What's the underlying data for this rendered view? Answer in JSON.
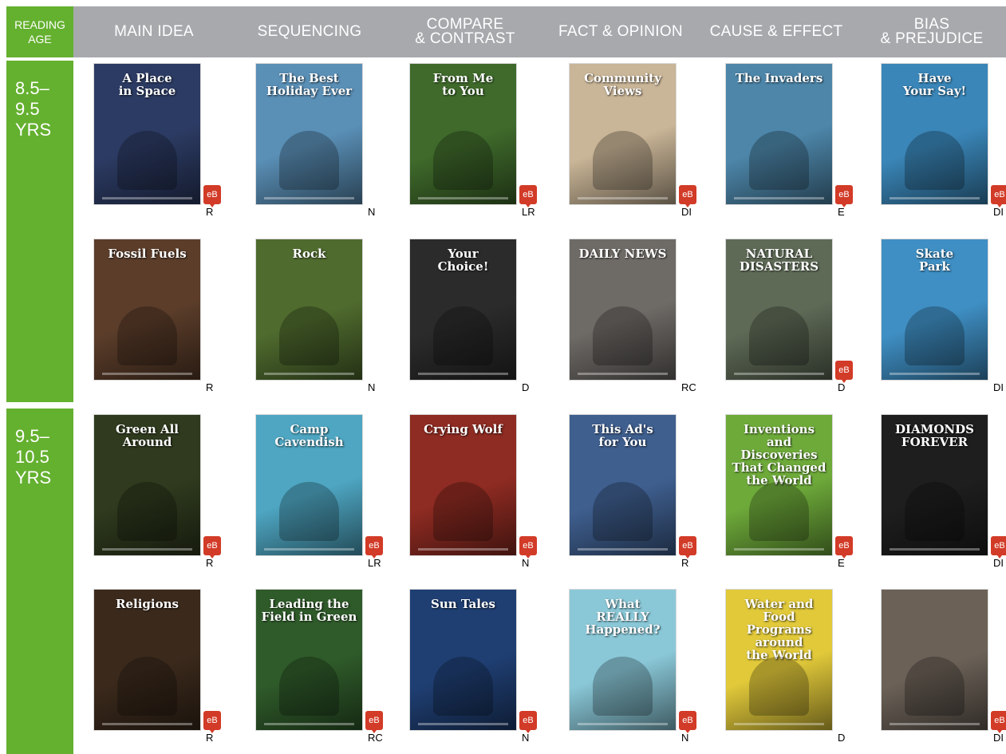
{
  "header": {
    "age_label": "READING\nAGE",
    "columns": [
      "MAIN IDEA",
      "SEQUENCING",
      "COMPARE\n& CONTRAST",
      "FACT & OPINION",
      "CAUSE & EFFECT",
      "BIAS\n& PREJUDICE"
    ]
  },
  "age_bands": [
    "8.5–\n9.5\nYRS",
    "9.5–\n10.5\nYRS"
  ],
  "ebook_badge": "eB",
  "books": [
    [
      {
        "title": "A Place\nin Space",
        "level": "R",
        "ebook": true,
        "color": "#2c3b63"
      },
      {
        "title": "The Best\nHoliday Ever",
        "level": "N",
        "ebook": false,
        "color": "#5a8fb6"
      },
      {
        "title": "From Me\nto You",
        "level": "LR",
        "ebook": true,
        "color": "#3f6a2b"
      },
      {
        "title": "Community\nViews",
        "level": "DI",
        "ebook": true,
        "color": "#c9b597"
      },
      {
        "title": "The Invaders",
        "level": "E",
        "ebook": true,
        "color": "#4d86a9"
      },
      {
        "title": "Have\nYour Say!",
        "level": "DI",
        "ebook": true,
        "color": "#3a86b8"
      }
    ],
    [
      {
        "title": "Fossil Fuels",
        "level": "R",
        "ebook": false,
        "color": "#5b3d2a"
      },
      {
        "title": "Rock",
        "level": "N",
        "ebook": false,
        "color": "#4f6b2e"
      },
      {
        "title": "Your\nChoice!",
        "level": "D",
        "ebook": false,
        "color": "#2b2b2b"
      },
      {
        "title": "DAILY NEWS",
        "level": "RC",
        "ebook": false,
        "color": "#6e6a66"
      },
      {
        "title": "NATURAL DISASTERS",
        "level": "D",
        "ebook": true,
        "color": "#5e6a56"
      },
      {
        "title": "Skate\nPark",
        "level": "DI",
        "ebook": false,
        "color": "#3f8fc4"
      }
    ],
    [
      {
        "title": "Green All\nAround",
        "level": "R",
        "ebook": true,
        "color": "#2f3a1e"
      },
      {
        "title": "Camp\nCavendish",
        "level": "LR",
        "ebook": true,
        "color": "#4ea6c2"
      },
      {
        "title": "Crying Wolf",
        "level": "N",
        "ebook": true,
        "color": "#8e2b22"
      },
      {
        "title": "This Ad's\nfor You",
        "level": "R",
        "ebook": true,
        "color": "#3f5f8f"
      },
      {
        "title": "Inventions and\nDiscoveries\nThat Changed\nthe World",
        "level": "E",
        "ebook": true,
        "color": "#6eaa3a"
      },
      {
        "title": "DIAMONDS\nFOREVER",
        "level": "DI",
        "ebook": true,
        "color": "#1e1e1e"
      }
    ],
    [
      {
        "title": "Religions",
        "level": "R",
        "ebook": true,
        "color": "#3b2a1c"
      },
      {
        "title": "Leading the\nField in Green",
        "level": "RC",
        "ebook": true,
        "color": "#2f5b2a"
      },
      {
        "title": "Sun Tales",
        "level": "N",
        "ebook": true,
        "color": "#1f3f73"
      },
      {
        "title": "What\nREALLY\nHappened?",
        "level": "N",
        "ebook": true,
        "color": "#8ac8d8"
      },
      {
        "title": "Water and Food\nPrograms around\nthe World",
        "level": "D",
        "ebook": false,
        "color": "#e1c93a"
      },
      {
        "title": "",
        "level": "DI",
        "ebook": true,
        "color": "#6b6157"
      }
    ]
  ]
}
